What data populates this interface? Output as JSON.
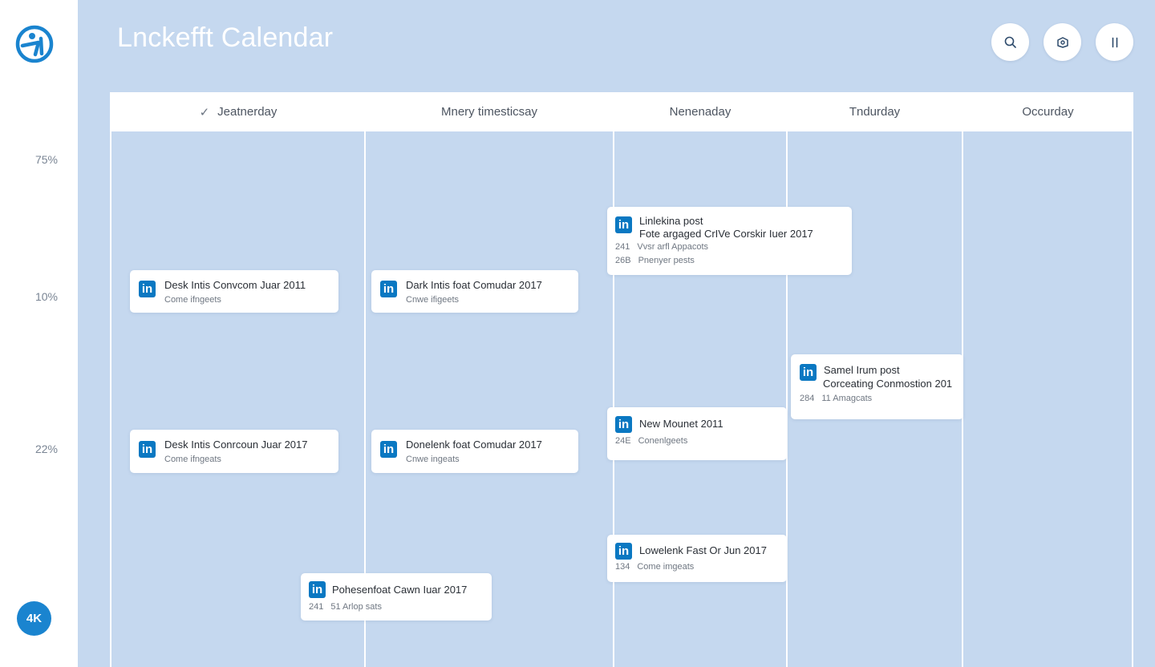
{
  "app": {
    "title": "Lnckefft Calendar",
    "accent_color": "#1a84cf",
    "background_color": "#c5d8ef"
  },
  "sidebar": {
    "logo_icon": "brand-logo-icon",
    "scale_labels": [
      "75%",
      "10%",
      "22%"
    ],
    "badge_label": "4K"
  },
  "toolbar": {
    "buttons": [
      {
        "icon": "search-icon"
      },
      {
        "icon": "share-icon"
      },
      {
        "icon": "pause-icon"
      }
    ]
  },
  "days": [
    {
      "label": "Jeatnerday",
      "checked": true
    },
    {
      "label": "Mnery timesticsay",
      "checked": false
    },
    {
      "label": "Nenenaday",
      "checked": false
    },
    {
      "label": "Tndurday",
      "checked": false
    },
    {
      "label": "Occurday",
      "checked": false
    }
  ],
  "posts": [
    {
      "title": "Desk Intis Convcom Juar 2011",
      "meta_num": "",
      "meta_text": "Come ifngeets"
    },
    {
      "title": "Dark Intis foat Comudar 2017",
      "meta_num": "",
      "meta_text": "Cnwe ifigeets"
    },
    {
      "title": "Linlekina post",
      "line2": "Fote argaged CrIVe Corskir Iuer 2017",
      "meta": [
        {
          "num": "241",
          "text": "Vvsr arfl Appacots"
        },
        {
          "num": "26B",
          "text": "Pnenyer pests"
        }
      ]
    },
    {
      "title": "Samel Irum post",
      "line2": "Corceating Conmostion 201",
      "meta_num": "284",
      "meta_text": "11 Amagcats"
    },
    {
      "title": "New Mounet 2011",
      "meta_num": "24E",
      "meta_text": "Conenlgeets"
    },
    {
      "title": "Desk Intis Conrcoun Juar 2017",
      "meta_num": "",
      "meta_text": "Come ifngeats"
    },
    {
      "title": "Donelenk foat Comudar 2017",
      "meta_num": "",
      "meta_text": "Cnwe ingeats"
    },
    {
      "title": "Lowelenk Fast Or Jun 2017",
      "meta_num": "134",
      "meta_text": "Come imgeats"
    },
    {
      "title": "Pohesenfoat Cawn Iuar 2017",
      "meta_num": "241",
      "meta_text": "51 Arlop sats"
    }
  ]
}
